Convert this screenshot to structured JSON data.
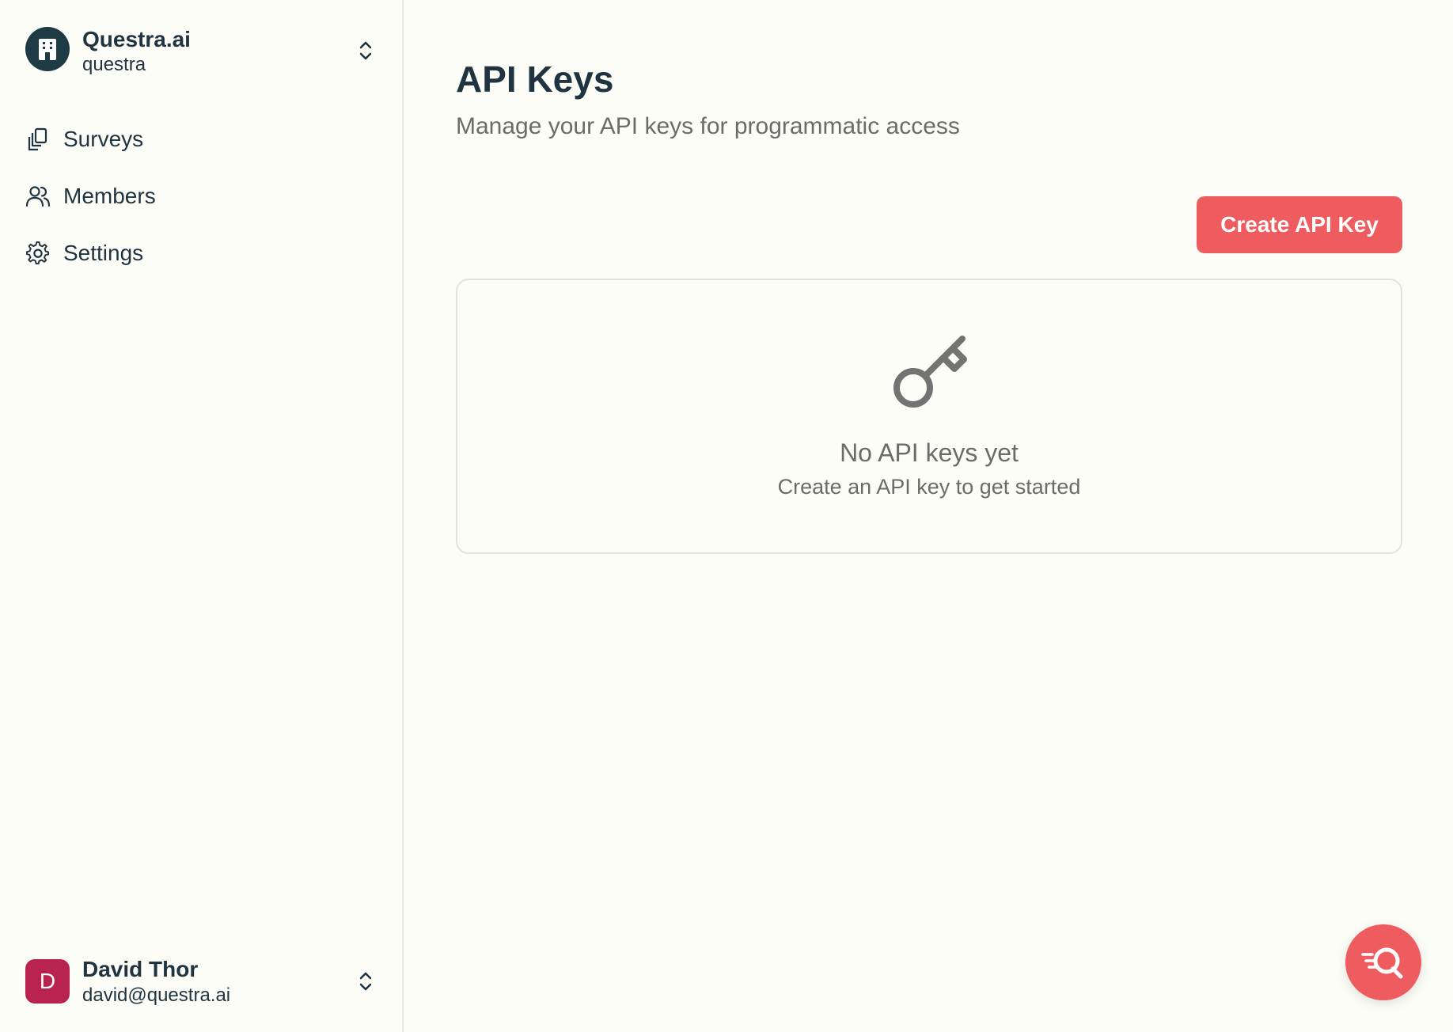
{
  "org": {
    "name": "Questra.ai",
    "slug": "questra",
    "avatar_icon": "building-icon",
    "avatar_color": "#1d3a45"
  },
  "nav": {
    "items": [
      {
        "label": "Surveys",
        "icon": "documents-icon"
      },
      {
        "label": "Members",
        "icon": "users-icon"
      },
      {
        "label": "Settings",
        "icon": "gear-icon"
      }
    ]
  },
  "user": {
    "initial": "D",
    "name": "David Thor",
    "email": "david@questra.ai",
    "avatar_color": "#b8244f"
  },
  "main": {
    "title": "API Keys",
    "subtitle": "Manage your API keys for programmatic access",
    "create_button": "Create API Key",
    "empty_state": {
      "icon": "key-icon",
      "title": "No API keys yet",
      "description": "Create an API key to get started"
    }
  },
  "fab": {
    "icon": "chat-search-icon"
  },
  "colors": {
    "accent": "#ee5c60",
    "background": "#fdfdf8",
    "text_primary": "#1f3340",
    "text_muted": "#6b6b6b"
  }
}
